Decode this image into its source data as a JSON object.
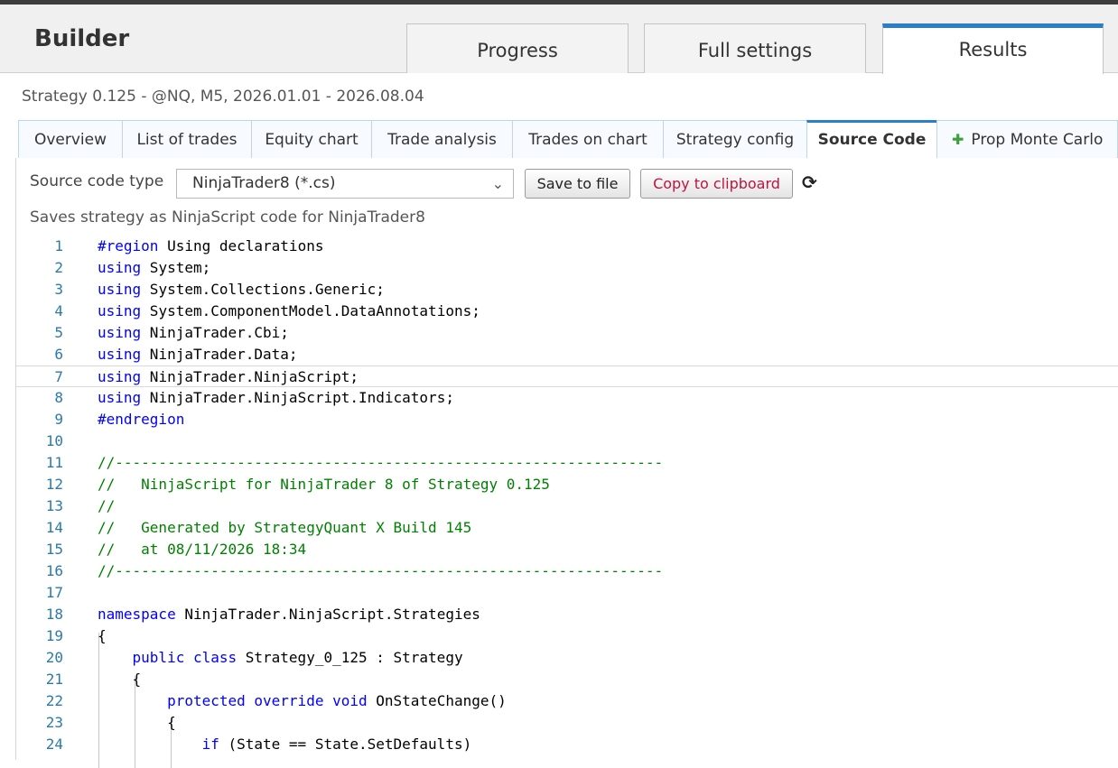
{
  "header": {
    "app_title": "Builder",
    "tabs": [
      "Progress",
      "Full settings",
      "Results"
    ],
    "active_tab": "Results"
  },
  "subtitle": "Strategy 0.125 - @NQ, M5, 2026.01.01 - 2026.08.04",
  "subtabs": [
    "Overview",
    "List of trades",
    "Equity chart",
    "Trade analysis",
    "Trades on chart",
    "Strategy config",
    "Source Code",
    "Prop Monte Carlo"
  ],
  "active_subtab": "Source Code",
  "toolbar": {
    "label": "Source code type",
    "selected": "NinjaTrader8 (*.cs)",
    "save_label": "Save to file",
    "copy_label": "Copy to clipboard",
    "description": "Saves strategy as NinjaScript code for NinjaTrader8"
  },
  "colors": {
    "accent": "#2a7fc9",
    "keyword": "#0000ff",
    "comment": "#008000",
    "line_number": "#2b7ba6"
  },
  "code_lines": [
    [
      [
        "kw",
        "#region"
      ],
      [
        "t",
        " Using declarations"
      ]
    ],
    [
      [
        "kw",
        "using"
      ],
      [
        "t",
        " System;"
      ]
    ],
    [
      [
        "kw",
        "using"
      ],
      [
        "t",
        " System.Collections.Generic;"
      ]
    ],
    [
      [
        "kw",
        "using"
      ],
      [
        "t",
        " System.ComponentModel.DataAnnotations;"
      ]
    ],
    [
      [
        "kw",
        "using"
      ],
      [
        "t",
        " NinjaTrader.Cbi;"
      ]
    ],
    [
      [
        "kw",
        "using"
      ],
      [
        "t",
        " NinjaTrader.Data;"
      ]
    ],
    [
      [
        "kw",
        "using"
      ],
      [
        "t",
        " NinjaTrader.NinjaScript;"
      ]
    ],
    [
      [
        "kw",
        "using"
      ],
      [
        "t",
        " NinjaTrader.NinjaScript.Indicators;"
      ]
    ],
    [
      [
        "kw",
        "#endregion"
      ]
    ],
    [],
    [
      [
        "cm",
        "//---------------------------------------------------------------"
      ]
    ],
    [
      [
        "cm",
        "//   NinjaScript for NinjaTrader 8 of Strategy 0.125"
      ]
    ],
    [
      [
        "cm",
        "//"
      ]
    ],
    [
      [
        "cm",
        "//   Generated by StrategyQuant X Build 145"
      ]
    ],
    [
      [
        "cm",
        "//   at 08/11/2026 18:34"
      ]
    ],
    [
      [
        "cm",
        "//---------------------------------------------------------------"
      ]
    ],
    [],
    [
      [
        "kw",
        "namespace"
      ],
      [
        "t",
        " NinjaTrader.NinjaScript.Strategies"
      ]
    ],
    [
      [
        "t",
        "{"
      ]
    ],
    [
      [
        "t",
        "    "
      ],
      [
        "kw",
        "public class"
      ],
      [
        "t",
        " Strategy_0_125 : Strategy"
      ]
    ],
    [
      [
        "t",
        "    {"
      ]
    ],
    [
      [
        "t",
        "        "
      ],
      [
        "kw",
        "protected override void"
      ],
      [
        "t",
        " OnStateChange()"
      ]
    ],
    [
      [
        "t",
        "        {"
      ]
    ],
    [
      [
        "t",
        "            "
      ],
      [
        "kw",
        "if"
      ],
      [
        "t",
        " (State == State.SetDefaults)"
      ]
    ]
  ],
  "current_line": 7
}
